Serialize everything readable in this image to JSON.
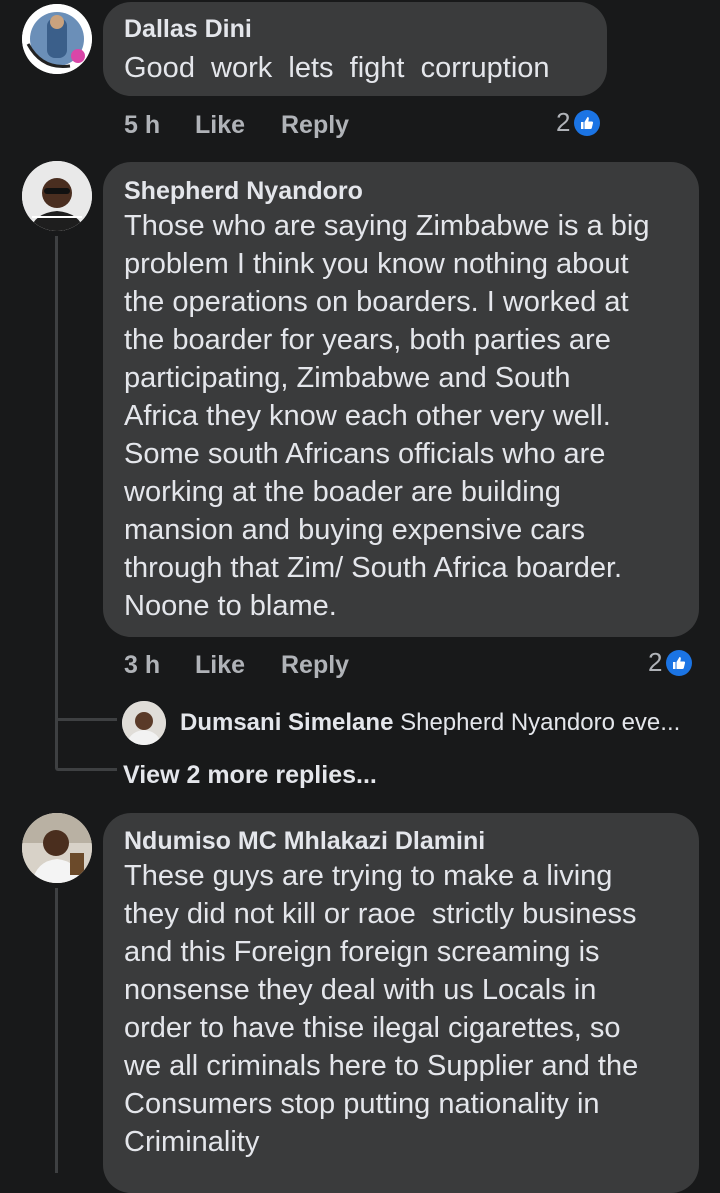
{
  "comments": [
    {
      "author": "Dallas Dini",
      "lines": [
        "Good  work  lets  fight  corruption"
      ],
      "time": "5 h",
      "like_label": "Like",
      "reply_label": "Reply",
      "reaction_count": "2",
      "avatar_icon": "profile-photo-vaccinated-frame"
    },
    {
      "author": "Shepherd Nyandoro",
      "lines": [
        "Those who are saying Zimbabwe is a big",
        "problem I think you know nothing about",
        "the operations on boarders. I worked at",
        "the boarder for years, both parties are",
        "participating, Zimbabwe and South",
        "Africa they know each other very well.",
        "Some south Africans officials who are",
        "working at the boader are building",
        "mansion and buying expensive cars",
        "through that Zim/ South Africa boarder.",
        "Noone to blame."
      ],
      "time": "3 h",
      "like_label": "Like",
      "reply_label": "Reply",
      "reaction_count": "2",
      "avatar_icon": "profile-photo"
    },
    {
      "author": "Ndumiso MC Mhlakazi Dlamini",
      "lines": [
        "These guys are trying to make a living",
        "they did not kill or raoe  strictly business",
        "and this Foreign foreign screaming is",
        "nonsense they deal with us Locals in",
        "order to have thise ilegal cigarettes, so",
        "we all criminals here to Supplier and the",
        "Consumers stop putting nationality in",
        "Criminality"
      ],
      "avatar_icon": "profile-photo"
    }
  ],
  "reply_preview": {
    "author": "Dumsani Simelane",
    "text": "Shepherd Nyandoro eve..."
  },
  "view_more_replies": "View 2 more replies...",
  "colors": {
    "background": "#18191a",
    "bubble": "#3a3b3c",
    "text": "#e4e6eb",
    "secondary_text": "#b0b3b8",
    "like_blue": "#1b74e4"
  }
}
